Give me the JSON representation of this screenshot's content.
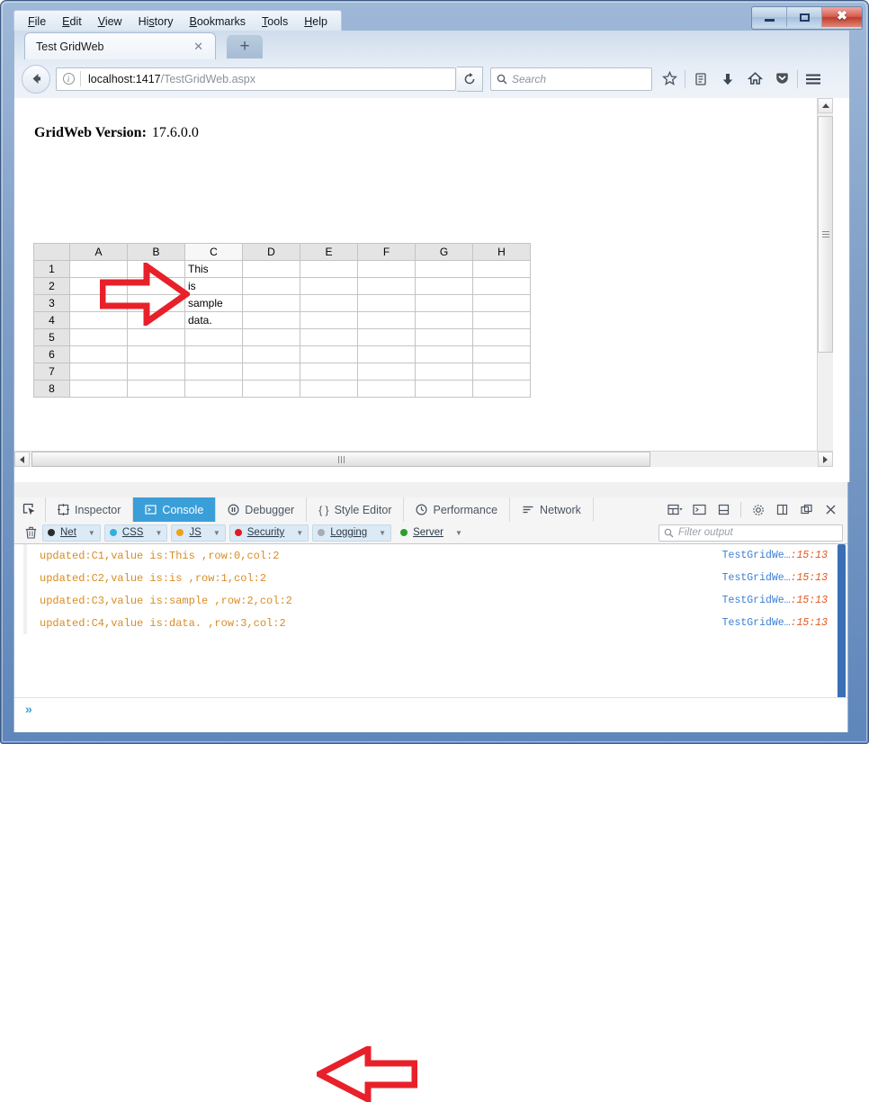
{
  "window": {
    "buttons": {
      "minimize": "–",
      "maximize": "❑",
      "close": "✕"
    }
  },
  "menubar": {
    "items": [
      {
        "label": "File",
        "pre": "",
        "key": "F",
        "post": "ile"
      },
      {
        "label": "Edit",
        "pre": "",
        "key": "E",
        "post": "dit"
      },
      {
        "label": "View",
        "pre": "",
        "key": "V",
        "post": "iew"
      },
      {
        "label": "History",
        "pre": "Hi",
        "key": "s",
        "post": "tory"
      },
      {
        "label": "Bookmarks",
        "pre": "",
        "key": "B",
        "post": "ookmarks"
      },
      {
        "label": "Tools",
        "pre": "",
        "key": "T",
        "post": "ools"
      },
      {
        "label": "Help",
        "pre": "",
        "key": "H",
        "post": "elp"
      }
    ]
  },
  "tabbar": {
    "tab_title": "Test GridWeb",
    "close_glyph": "✕",
    "newtab_glyph": "+"
  },
  "navbar": {
    "url_host": "localhost:1417",
    "url_path": "/TestGridWeb.aspx",
    "search_placeholder": "Search",
    "icons": [
      "bookmark-star-icon",
      "reading-list-icon",
      "downloads-icon",
      "home-icon",
      "pocket-icon",
      "menu-hamburger-icon"
    ]
  },
  "page": {
    "version_label": "GridWeb Version:",
    "version_value": "17.6.0.0",
    "sheet": {
      "columns": [
        "A",
        "B",
        "C",
        "D",
        "E",
        "F",
        "G",
        "H"
      ],
      "selected_column": "C",
      "rows": [
        "1",
        "2",
        "3",
        "4",
        "5",
        "6",
        "7",
        "8"
      ],
      "cells": [
        [
          "",
          "",
          "This",
          "",
          "",
          "",
          "",
          ""
        ],
        [
          "",
          "",
          "is",
          "",
          "",
          "",
          "",
          ""
        ],
        [
          "",
          "",
          "sample",
          "",
          "",
          "",
          "",
          ""
        ],
        [
          "",
          "",
          "data.",
          "",
          "",
          "",
          "",
          ""
        ],
        [
          "",
          "",
          "",
          "",
          "",
          "",
          "",
          ""
        ],
        [
          "",
          "",
          "",
          "",
          "",
          "",
          "",
          ""
        ],
        [
          "",
          "",
          "",
          "",
          "",
          "",
          "",
          ""
        ],
        [
          "",
          "",
          "",
          "",
          "",
          "",
          "",
          ""
        ]
      ]
    },
    "annotation_arrow_color": "#e8202a"
  },
  "devtools": {
    "tabs": [
      {
        "label": "Inspector",
        "icon": "inspector-icon",
        "active": false
      },
      {
        "label": "Console",
        "icon": "console-icon",
        "active": true
      },
      {
        "label": "Debugger",
        "icon": "debugger-icon",
        "active": false
      },
      {
        "label": "Style Editor",
        "icon": "style-editor-icon",
        "active": false
      },
      {
        "label": "Performance",
        "icon": "performance-icon",
        "active": false
      },
      {
        "label": "Network",
        "icon": "network-icon",
        "active": false
      }
    ],
    "tools": [
      "responsive-design-icon",
      "split-console-icon",
      "dock-bottom-icon",
      "settings-gear-icon",
      "dock-side-icon",
      "detach-window-icon",
      "close-devtools-icon"
    ],
    "filters": [
      {
        "label": "Net",
        "color": "#2b2b2b",
        "caret": true
      },
      {
        "label": "CSS",
        "color": "#31b0e0",
        "caret": true
      },
      {
        "label": "JS",
        "color": "#f0a118",
        "caret": true
      },
      {
        "label": "Security",
        "color": "#e01b24",
        "caret": true
      },
      {
        "label": "Logging",
        "color": "#a8adb4",
        "caret": true
      },
      {
        "label": "Server",
        "color": "#2aa02a",
        "caret": true,
        "plain": true
      }
    ],
    "filter_placeholder": "Filter output",
    "log": [
      {
        "message": "updated:C1,value is:This ,row:0,col:2",
        "source": "TestGridWe…",
        "position": ":15:13"
      },
      {
        "message": "updated:C2,value is:is ,row:1,col:2",
        "source": "TestGridWe…",
        "position": ":15:13"
      },
      {
        "message": "updated:C3,value is:sample ,row:2,col:2",
        "source": "TestGridWe…",
        "position": ":15:13"
      },
      {
        "message": "updated:C4,value is:data. ,row:3,col:2",
        "source": "TestGridWe…",
        "position": ":15:13"
      }
    ],
    "prompt": "»"
  },
  "colors": {
    "accent_blue": "#3a9fd8",
    "log_text": "#d98c25",
    "source_link": "#3a7fd5",
    "source_line": "#e2571e",
    "annotation_red": "#e8202a"
  }
}
